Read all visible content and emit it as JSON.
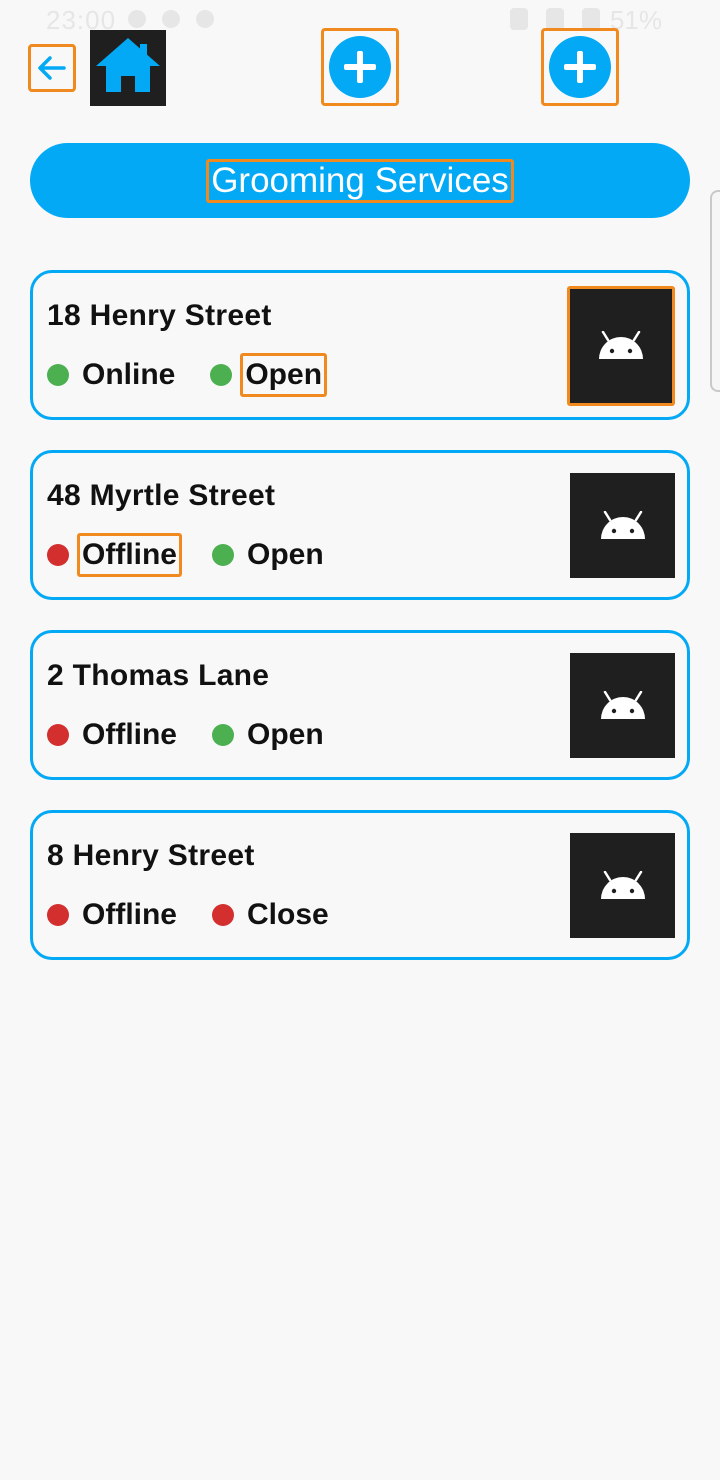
{
  "status_bar": {
    "time": "23:00",
    "battery": "51%"
  },
  "toolbar": {
    "back_icon": "arrow-left-icon",
    "home_icon": "home-icon",
    "add_icon": "plus-circle-icon"
  },
  "header": {
    "title": "Grooming Services"
  },
  "colors": {
    "accent": "#03a9f4",
    "online": "#4caf50",
    "offline": "#d32f2f",
    "highlight": "#f08a1e"
  },
  "locations": [
    {
      "name": "18 Henry Street",
      "connection": "Online",
      "connection_color": "green",
      "state": "Open",
      "state_color": "green"
    },
    {
      "name": "48 Myrtle Street",
      "connection": "Offline",
      "connection_color": "red",
      "state": "Open",
      "state_color": "green"
    },
    {
      "name": "2 Thomas Lane",
      "connection": "Offline",
      "connection_color": "red",
      "state": "Open",
      "state_color": "green"
    },
    {
      "name": "8 Henry Street",
      "connection": "Offline",
      "connection_color": "red",
      "state": "Close",
      "state_color": "red"
    }
  ]
}
